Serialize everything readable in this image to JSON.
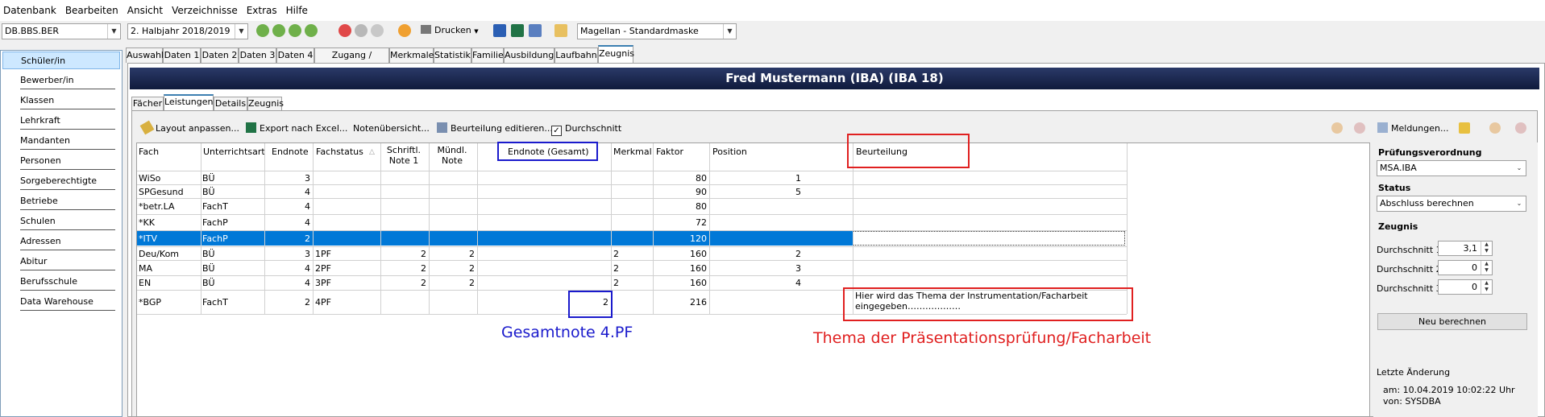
{
  "menu": [
    "Datenbank",
    "Bearbeiten",
    "Ansicht",
    "Verzeichnisse",
    "Extras",
    "Hilfe"
  ],
  "toolbar": {
    "db_combo": "DB.BBS.BER",
    "period_combo": "2. Halbjahr 2018/2019",
    "print_label": "Drucken",
    "mask_combo": "Magellan - Standardmaske"
  },
  "sidebar": {
    "items": [
      "Schüler/in",
      "Bewerber/in",
      "Klassen",
      "Lehrkraft",
      "Mandanten",
      "Personen",
      "Sorgeberechtigte",
      "Betriebe",
      "Schulen",
      "Adressen",
      "Abitur",
      "Berufsschule",
      "Data Warehouse"
    ]
  },
  "tabs": [
    "Auswahl",
    "Daten 1",
    "Daten 2",
    "Daten 3",
    "Daten 4",
    "Zugang / Abgang",
    "Merkmale",
    "Statistik",
    "Familie",
    "Ausbildung",
    "Laufbahn",
    "Zeugnis"
  ],
  "student_title": "Fred Mustermann (IBA) (IBA 18)",
  "subtabs": [
    "Fächer",
    "Leistungen",
    "Details",
    "Zeugnis"
  ],
  "actions": {
    "layout": "Layout anpassen...",
    "export": "Export nach Excel...",
    "notes": "Notenübersicht...",
    "edit_eval": "Beurteilung editieren...",
    "average": "Durchschnitt",
    "messages": "Meldungen..."
  },
  "grid": {
    "headers": [
      "Fach",
      "Unterrichtsart",
      "Endnote",
      "Fachstatus",
      "Schriftl. Note 1",
      "Mündl. Note",
      "Endnote (Gesamt)",
      "Merkmal",
      "Faktor",
      "Position",
      "Beurteilung"
    ],
    "rows": [
      {
        "fach": "WiSo",
        "art": "BÜ",
        "endnote": "3",
        "status": "",
        "schr": "",
        "muendl": "",
        "gesamt": "",
        "merkmal": "",
        "faktor": "80",
        "pos": "1",
        "beurt": ""
      },
      {
        "fach": "SPGesund",
        "art": "BÜ",
        "endnote": "4",
        "status": "",
        "schr": "",
        "muendl": "",
        "gesamt": "",
        "merkmal": "",
        "faktor": "90",
        "pos": "5",
        "beurt": ""
      },
      {
        "fach": "*betr.LA",
        "art": "FachT",
        "endnote": "4",
        "status": "",
        "schr": "",
        "muendl": "",
        "gesamt": "",
        "merkmal": "",
        "faktor": "80",
        "pos": "",
        "beurt": ""
      },
      {
        "fach": "*KK",
        "art": "FachP",
        "endnote": "4",
        "status": "",
        "schr": "",
        "muendl": "",
        "gesamt": "",
        "merkmal": "",
        "faktor": "72",
        "pos": "",
        "beurt": ""
      },
      {
        "fach": "*ITV",
        "art": "FachP",
        "endnote": "2",
        "status": "",
        "schr": "",
        "muendl": "",
        "gesamt": "",
        "merkmal": "",
        "faktor": "120",
        "pos": "",
        "beurt": ""
      },
      {
        "fach": "Deu/Kom",
        "art": "BÜ",
        "endnote": "3",
        "status": "1PF",
        "schr": "2",
        "muendl": "2",
        "gesamt": "",
        "merkmal": "2",
        "faktor": "160",
        "pos": "2",
        "beurt": ""
      },
      {
        "fach": "MA",
        "art": "BÜ",
        "endnote": "4",
        "status": "2PF",
        "schr": "2",
        "muendl": "2",
        "gesamt": "",
        "merkmal": "2",
        "faktor": "160",
        "pos": "3",
        "beurt": ""
      },
      {
        "fach": "EN",
        "art": "BÜ",
        "endnote": "4",
        "status": "3PF",
        "schr": "2",
        "muendl": "2",
        "gesamt": "",
        "merkmal": "2",
        "faktor": "160",
        "pos": "4",
        "beurt": ""
      },
      {
        "fach": "*BGP",
        "art": "FachT",
        "endnote": "2",
        "status": "4PF",
        "schr": "",
        "muendl": "",
        "gesamt": "2",
        "merkmal": "",
        "faktor": "216",
        "pos": "",
        "beurt": "Hier wird das Thema der Instrumentation/Facharbeit eingegeben………………"
      }
    ]
  },
  "annotations": {
    "blue": "Gesamtnote 4.PF",
    "red": "Thema der Präsentationsprüfung/Facharbeit"
  },
  "right": {
    "pv_label": "Prüfungsverordnung",
    "pv_value": "MSA.IBA",
    "status_label": "Status",
    "status_value": "Abschluss berechnen",
    "zeugnis_label": "Zeugnis",
    "d1_label": "Durchschnitt 1",
    "d1_value": "3,1",
    "d2_label": "Durchschnitt 2",
    "d2_value": "0",
    "d3_label": "Durchschnitt 3",
    "d3_value": "0",
    "recalc": "Neu berechnen",
    "last_change_label": "Letzte Änderung",
    "am": "am:  10.04.2019 10:02:22 Uhr",
    "von": "von:  SYSDBA"
  },
  "colors": {
    "selection": "#0078d7",
    "annotation_red": "#e02020",
    "annotation_blue": "#1a1acc",
    "title_bar": "#0f1a3c"
  }
}
